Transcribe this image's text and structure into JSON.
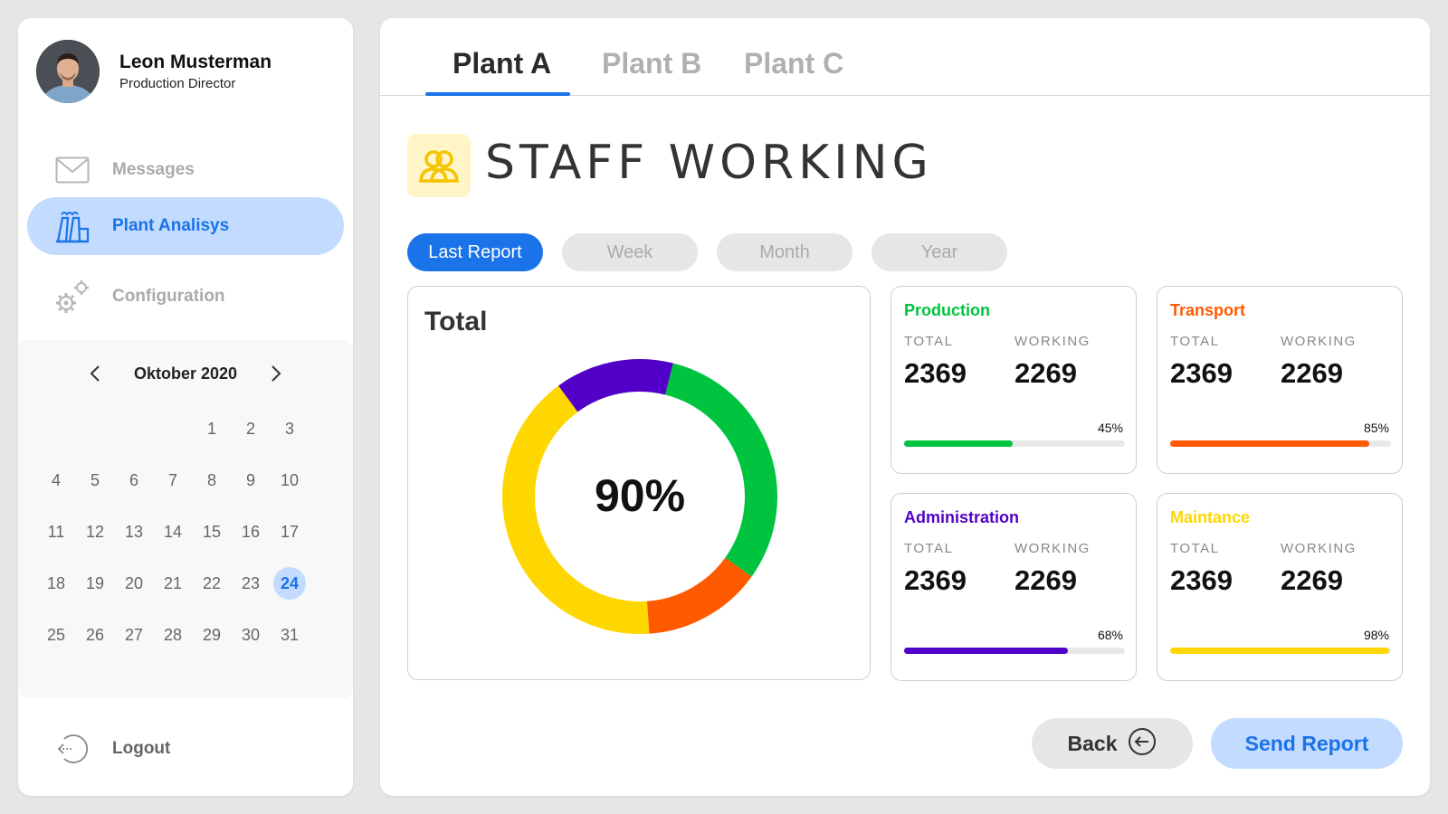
{
  "user": {
    "name": "Leon Musterman",
    "role": "Production Director"
  },
  "nav": {
    "messages": "Messages",
    "plant": "Plant Analisys",
    "config": "Configuration",
    "logout": "Logout"
  },
  "calendar": {
    "month": "Oktober 2020",
    "selected_day": 24,
    "days": [
      "1",
      "2",
      "3",
      "4",
      "5",
      "6",
      "7",
      "8",
      "9",
      "10",
      "11",
      "12",
      "13",
      "14",
      "15",
      "16",
      "17",
      "18",
      "19",
      "20",
      "21",
      "22",
      "23",
      "24",
      "25",
      "26",
      "27",
      "28",
      "29",
      "30",
      "31"
    ]
  },
  "tabs": [
    "Plant A",
    "Plant B",
    "Plant C"
  ],
  "active_tab": "Plant A",
  "section_title": "STAFF WORKING",
  "filters": [
    "Last Report",
    "Week",
    "Month",
    "Year"
  ],
  "active_filter": "Last Report",
  "total": {
    "title": "Total",
    "value": "90%"
  },
  "chart_data": {
    "type": "pie",
    "categories": [
      "Production",
      "Transport",
      "Maintance",
      "Administration"
    ],
    "values": [
      31,
      14,
      41,
      14
    ],
    "colors": [
      "#00c440",
      "#ff5a00",
      "#ffd700",
      "#5200c8"
    ],
    "center_label": "90%"
  },
  "cards": {
    "production": {
      "title": "Production",
      "total_label": "TOTAL",
      "working_label": "WORKING",
      "total": "2369",
      "working": "2269",
      "percent": "45%",
      "fraction": 0.49,
      "color": "#00c440"
    },
    "transport": {
      "title": "Transport",
      "total_label": "TOTAL",
      "working_label": "WORKING",
      "total": "2369",
      "working": "2269",
      "percent": "85%",
      "fraction": 0.9,
      "color": "#ff5a00"
    },
    "administration": {
      "title": "Administration",
      "total_label": "TOTAL",
      "working_label": "WORKING",
      "total": "2369",
      "working": "2269",
      "percent": "68%",
      "fraction": 0.74,
      "color": "#5200c8"
    },
    "maintance": {
      "title": "Maintance",
      "total_label": "TOTAL",
      "working_label": "WORKING",
      "total": "2369",
      "working": "2269",
      "percent": "98%",
      "fraction": 0.99,
      "color": "#ffd700"
    }
  },
  "buttons": {
    "back": "Back",
    "send": "Send Report"
  },
  "colors": {
    "accent": "#1a73e8",
    "accent_light": "#c3dbff"
  },
  "icons": {
    "messages": "envelope-icon",
    "plant": "factory-icon",
    "config": "gears-icon",
    "logout": "logout-icon",
    "staff": "users-icon",
    "back": "arrow-left-circle-icon"
  }
}
